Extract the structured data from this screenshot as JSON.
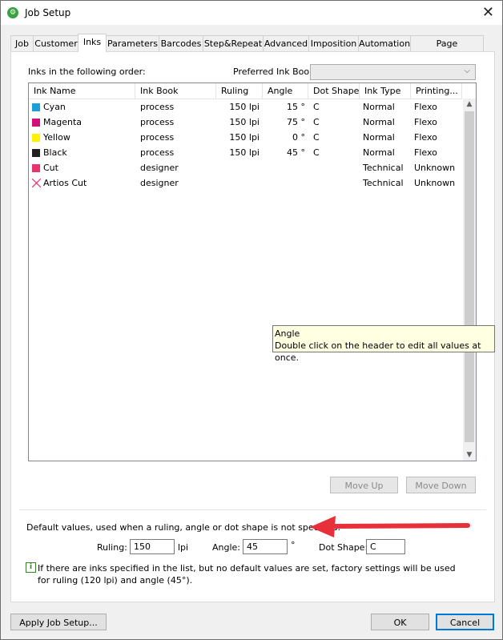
{
  "window": {
    "title": "Job Setup",
    "close_glyph": "✕"
  },
  "tabs": [
    {
      "label": "Job"
    },
    {
      "label": "Customer"
    },
    {
      "label": "Inks"
    },
    {
      "label": "Parameters"
    },
    {
      "label": "Barcodes"
    },
    {
      "label": "Step&Repeat"
    },
    {
      "label": "Advanced"
    },
    {
      "label": "Imposition"
    },
    {
      "label": "Automation"
    },
    {
      "label": "Page Assignment"
    }
  ],
  "inks_panel": {
    "order_label": "Inks in the following order:",
    "preferred_label": "Preferred Ink Book:",
    "preferred_value": "",
    "columns": [
      "Ink Name",
      "Ink Book",
      "Ruling",
      "Angle",
      "Dot Shape",
      "Ink Type",
      "Printing..."
    ],
    "rows": [
      {
        "name": "Cyan",
        "book": "process",
        "ruling": "150 lpi",
        "angle": "15 °",
        "dot": "C",
        "type": "Normal",
        "printing": "Flexo",
        "swatch": "#1a9fd8"
      },
      {
        "name": "Magenta",
        "book": "process",
        "ruling": "150 lpi",
        "angle": "75 °",
        "dot": "C",
        "type": "Normal",
        "printing": "Flexo",
        "swatch": "#d0117b"
      },
      {
        "name": "Yellow",
        "book": "process",
        "ruling": "150 lpi",
        "angle": "0 °",
        "dot": "C",
        "type": "Normal",
        "printing": "Flexo",
        "swatch": "#fff200"
      },
      {
        "name": "Black",
        "book": "process",
        "ruling": "150 lpi",
        "angle": "45 °",
        "dot": "C",
        "type": "Normal",
        "printing": "Flexo",
        "swatch": "#231f20"
      },
      {
        "name": "Cut",
        "book": "designer",
        "ruling": "",
        "angle": "",
        "dot": "",
        "type": "Technical",
        "printing": "Unknown",
        "swatch": "#e8336d"
      },
      {
        "name": "Artios Cut",
        "book": "designer",
        "ruling": "",
        "angle": "",
        "dot": "",
        "type": "Technical",
        "printing": "Unknown",
        "swatch": "artios-cut-icon"
      }
    ],
    "tooltip_title": "Angle",
    "tooltip_text": "Double click on the header to edit all values at once.",
    "move_up": "Move Up",
    "move_down": "Move Down",
    "defaults_label": "Default values, used when a ruling, angle or dot shape is not specified:",
    "ruling_label": "Ruling:",
    "ruling_value": "150",
    "ruling_unit": "lpi",
    "angle_label": "Angle:",
    "angle_value": "45",
    "angle_unit": "°",
    "dot_label": "Dot Shape:",
    "dot_value": "C",
    "note": "If there are inks specified in the list, but no default values are set, factory settings will be used for ruling (120 lpi) and angle (45°)."
  },
  "footer": {
    "apply": "Apply Job Setup...",
    "ok": "OK",
    "cancel": "Cancel"
  },
  "colors": {
    "accent": "#0078d7",
    "arrow": "#e8303a",
    "tooltip_bg": "#ffffe1"
  }
}
